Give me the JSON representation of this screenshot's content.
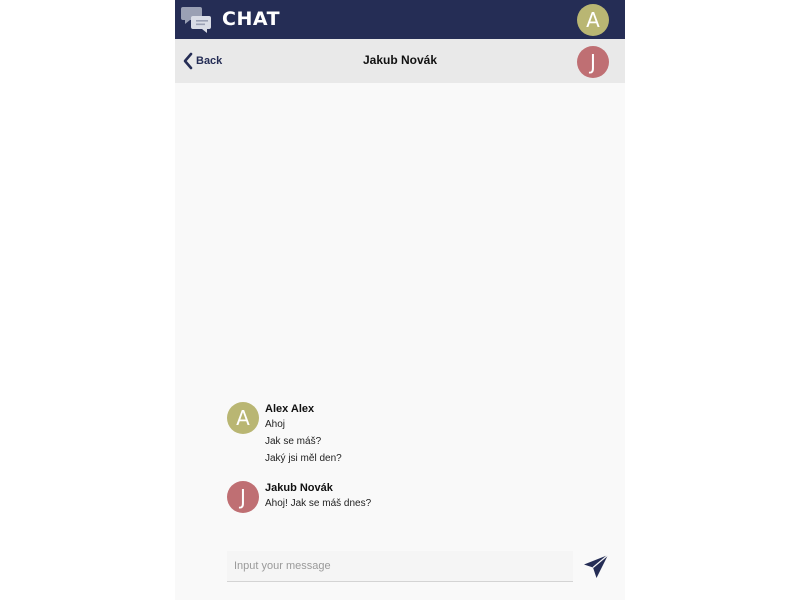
{
  "header": {
    "app_name": "CHAT",
    "logo_icon": "chat-bubbles-icon",
    "user_initial": "A",
    "user_avatar_color": "#b9b673"
  },
  "conversation": {
    "back_label": "Back",
    "title": "Jakub Novák",
    "contact_initial": "J",
    "contact_avatar_color": "#bf6f73"
  },
  "messages": [
    {
      "sender": "Alex Alex",
      "initial": "A",
      "avatar_color": "#b9b673",
      "lines": [
        "Ahoj",
        "Jak se máš?",
        "Jaký jsi měl den?"
      ]
    },
    {
      "sender": "Jakub Novák",
      "initial": "J",
      "avatar_color": "#bf6f73",
      "lines": [
        "Ahoj! Jak se máš dnes?"
      ]
    }
  ],
  "composer": {
    "placeholder": "Input your message",
    "value": "",
    "send_icon": "send-paper-plane-icon"
  },
  "colors": {
    "header_bg": "#252d55",
    "subheader_bg": "#e9e9e9",
    "chat_bg": "#f9f9f9",
    "accent": "#252d55"
  }
}
